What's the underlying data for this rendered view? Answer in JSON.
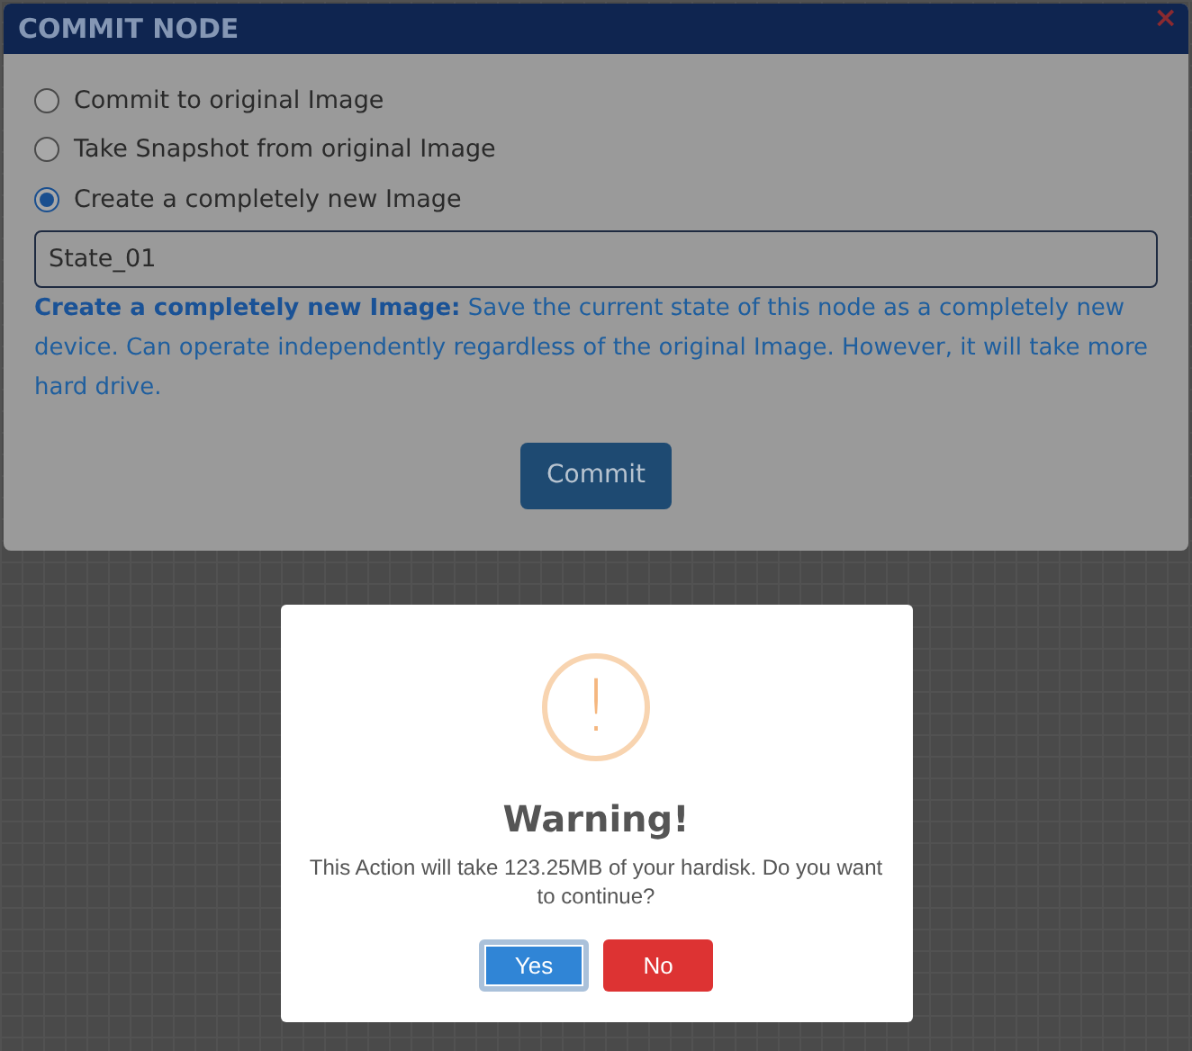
{
  "dialog": {
    "title": "COMMIT NODE",
    "close": "×",
    "options": [
      {
        "label": "Commit to original Image",
        "selected": false
      },
      {
        "label": "Take Snapshot from original Image",
        "selected": false
      },
      {
        "label": "Create a completely new Image",
        "selected": true
      }
    ],
    "name_field": {
      "value": "State_01"
    },
    "description": "**Create a completely new Image:** Save the current state of this node as a completely new device. Can operate independently regardless of the original Image. However, it will take more hard drive.",
    "commit_button": "Commit"
  },
  "alert": {
    "title": "Warning!",
    "message": "This Action will take 123.25MB of your hardisk. Do you want to continue?",
    "icon": "!",
    "buttons": [
      {
        "label": "Yes",
        "kind": "confirm",
        "focused": true
      },
      {
        "label": "No",
        "kind": "cancel",
        "focused": false
      }
    ]
  }
}
